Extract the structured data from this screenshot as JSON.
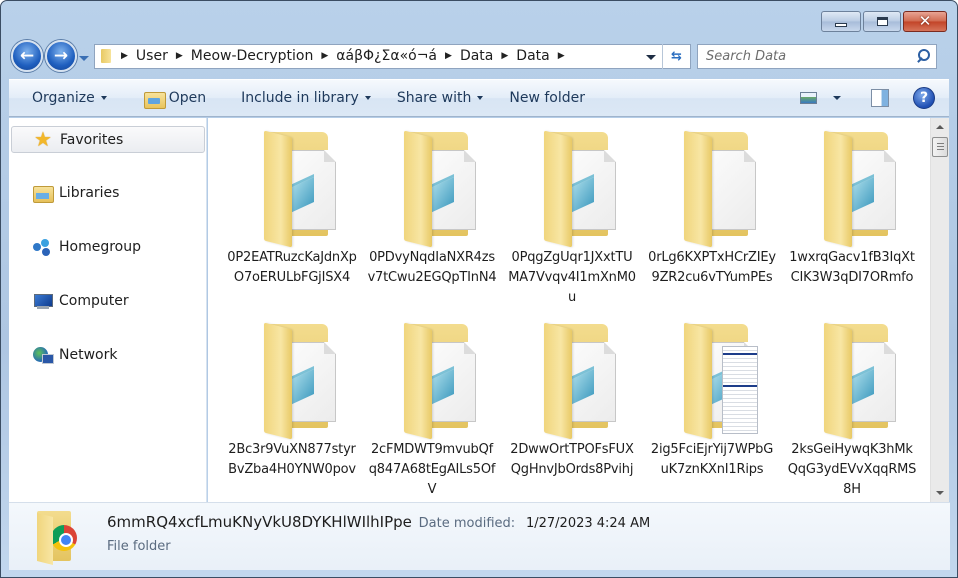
{
  "window": {
    "controls": {
      "minimize": "minimize",
      "maximize": "maximize",
      "close": "close"
    }
  },
  "nav": {
    "back_icon": "back-arrow-icon",
    "forward_icon": "forward-arrow-icon",
    "breadcrumbs": [
      "User",
      "Meow-Decryption",
      "αáβΦ¿Σα«ó¬á",
      "Data",
      "Data"
    ],
    "refresh_icon": "refresh-icon",
    "search_placeholder": "Search Data"
  },
  "toolbar": {
    "organize": "Organize",
    "open": "Open",
    "include_in_library": "Include in library",
    "share_with": "Share with",
    "new_folder": "New folder"
  },
  "sidebar": {
    "items": [
      {
        "label": "Favorites",
        "icon": "star-icon",
        "selected": true
      },
      {
        "label": "Libraries",
        "icon": "libraries-icon"
      },
      {
        "label": "Homegroup",
        "icon": "homegroup-icon"
      },
      {
        "label": "Computer",
        "icon": "computer-icon"
      },
      {
        "label": "Network",
        "icon": "network-icon"
      }
    ]
  },
  "files": [
    {
      "name": "0P2EATRuzcKaJdnXpO7oERULbFGjISX4",
      "preview": "notepad"
    },
    {
      "name": "0PDvyNqdIaNXR4zsv7tCwu2EGQpTInN4",
      "preview": "notepad"
    },
    {
      "name": "0PqgZgUqr1JXxtTUMA7Vvqv4I1mXnM0u",
      "preview": "notepad"
    },
    {
      "name": "0rLg6KXPTxHCrZIEy9ZR2cu6vTYumPEs",
      "preview": "blank"
    },
    {
      "name": "1wxrqGacv1fB3IqXtCIK3W3qDI7ORmfo",
      "preview": "notepad"
    },
    {
      "name": "2Bc3r9VuXN877styrBvZba4H0YNW0pov",
      "preview": "notepad"
    },
    {
      "name": "2cFMDWT9mvubQfq847A68tEgAILs5OfV",
      "preview": "notepad"
    },
    {
      "name": "2DwwOrtTPOFsFUXQgHnvJbOrds8Pvihj",
      "preview": "notepad"
    },
    {
      "name": "2ig5FciEjrYij7WPbGuK7znKXnI1Rips",
      "preview": "spreadsheet"
    },
    {
      "name": "2ksGeiHywqK3hMkQqG3ydEVvXqqRMS8H",
      "preview": "notepad"
    }
  ],
  "details": {
    "name": "6mmRQ4xcfLmuKNyVkU8DYKHlWIlhIPpe",
    "date_label": "Date modified:",
    "date_value": "1/27/2023 4:24 AM",
    "type": "File folder"
  }
}
